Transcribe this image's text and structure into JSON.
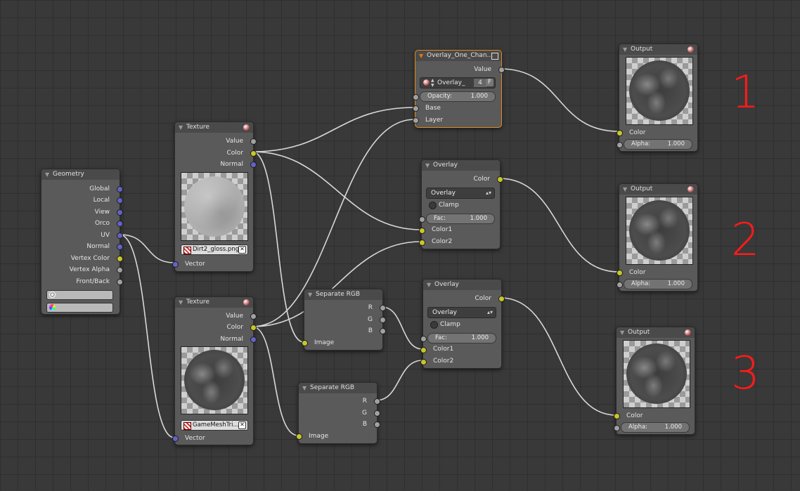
{
  "geometry": {
    "title": "Geometry",
    "outputs": [
      "Global",
      "Local",
      "View",
      "Orco",
      "UV",
      "Normal",
      "Vertex Color",
      "Vertex Alpha",
      "Front/Back"
    ]
  },
  "texture1": {
    "title": "Texture",
    "outputs": [
      "Value",
      "Color",
      "Normal"
    ],
    "image": "Dirt2_gloss.png",
    "input": "Vector"
  },
  "texture2": {
    "title": "Texture",
    "outputs": [
      "Value",
      "Color",
      "Normal"
    ],
    "image": "GameMeshTri...",
    "input": "Vector"
  },
  "group": {
    "title": "Overlay_One_Chan...",
    "output": "Value",
    "group_name": "Overlay_",
    "users": "4",
    "fake": "F",
    "opacity_label": "Opacity:",
    "opacity_value": "1.000",
    "inputs": [
      "Base",
      "Layer"
    ]
  },
  "mix1": {
    "title": "Overlay",
    "output": "Color",
    "mode": "Overlay",
    "clamp": "Clamp",
    "fac_label": "Fac:",
    "fac_value": "1.000",
    "inputs": [
      "Color1",
      "Color2"
    ]
  },
  "mix2": {
    "title": "Overlay",
    "output": "Color",
    "mode": "Overlay",
    "clamp": "Clamp",
    "fac_label": "Fac:",
    "fac_value": "1.000",
    "inputs": [
      "Color1",
      "Color2"
    ]
  },
  "sep1": {
    "title": "Separate RGB",
    "outputs": [
      "R",
      "G",
      "B"
    ],
    "input": "Image"
  },
  "sep2": {
    "title": "Separate RGB",
    "outputs": [
      "R",
      "G",
      "B"
    ],
    "input": "Image"
  },
  "out1": {
    "title": "Output",
    "inputs": [
      "Color"
    ],
    "alpha_label": "Alpha:",
    "alpha_value": "1.000"
  },
  "out2": {
    "title": "Output",
    "inputs": [
      "Color"
    ],
    "alpha_label": "Alpha:",
    "alpha_value": "1.000"
  },
  "out3": {
    "title": "Output",
    "inputs": [
      "Color"
    ],
    "alpha_label": "Alpha:",
    "alpha_value": "1.000"
  },
  "annotations": [
    "1",
    "2",
    "3"
  ],
  "colors": {
    "annotation": "#ff1a1a",
    "active_border": "#e08a22",
    "socket_color": "#c7c729",
    "socket_value": "#a1a1a1",
    "socket_vector": "#6363c7"
  }
}
